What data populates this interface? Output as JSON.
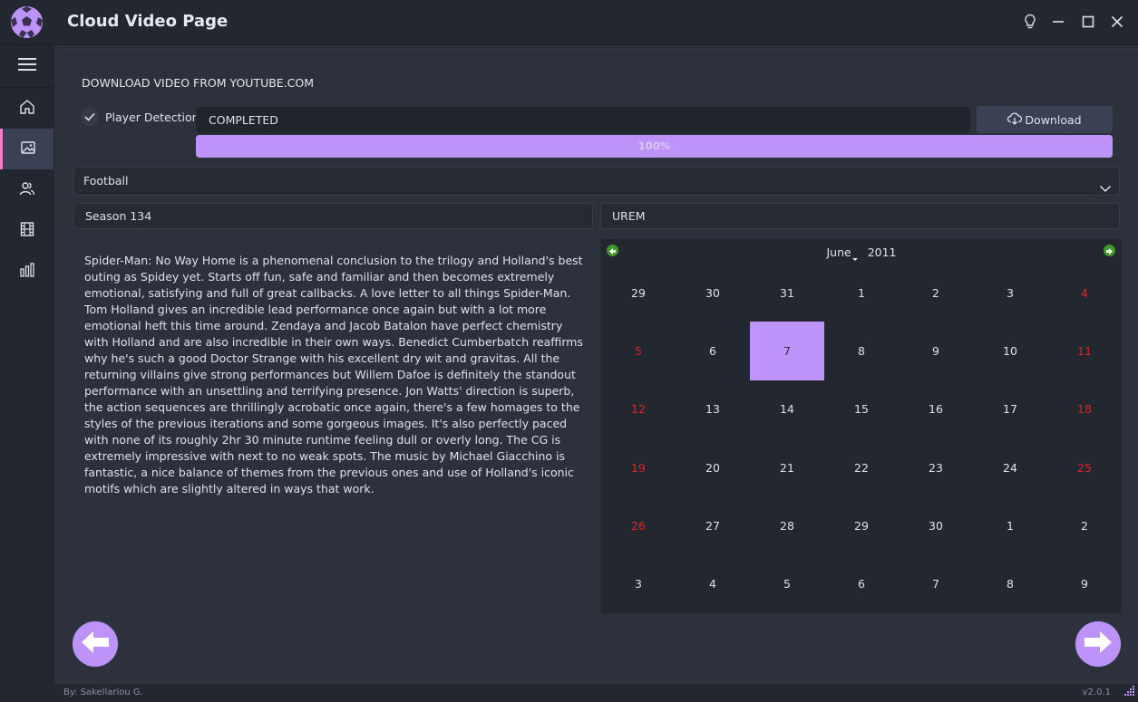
{
  "window": {
    "title": "Cloud Video Page",
    "buttons": [
      "lightbulb-icon",
      "minimize-icon",
      "maximize-icon",
      "close-icon"
    ]
  },
  "sidebar": {
    "items": [
      {
        "icon": "menu-icon"
      },
      {
        "icon": "home-icon"
      },
      {
        "icon": "image-icon",
        "active": true
      },
      {
        "icon": "users-icon"
      },
      {
        "icon": "film-icon"
      },
      {
        "icon": "chart-icon"
      }
    ]
  },
  "download": {
    "section_label": "DOWNLOAD VIDEO FROM YOUTUBE.COM",
    "player_detection_label": "Player Detection",
    "player_detection_checked": true,
    "status_value": "COMPLETED",
    "download_button": "Download",
    "progress_label": "100%",
    "progress_value": 100
  },
  "form": {
    "sport_selected": "Football",
    "season_value": "Season 134",
    "team_value": "UREM"
  },
  "review_text": "Spider-Man: No Way Home is a phenomenal conclusion to the trilogy and Holland's best outing as Spidey yet. Starts off fun, safe and familiar and then becomes extremely emotional, satisfying and full of great callbacks. A love letter to all things Spider-Man. Tom Holland gives an incredible lead performance once again but with a lot more emotional heft this time around. Zendaya and Jacob Batalon have perfect chemistry with Holland and are also incredible in their own ways. Benedict Cumberbatch reaffirms why he's such a good Doctor Strange with his excellent dry wit and gravitas. All the returning villains give strong performances but Willem Dafoe is definitely the standout performance with an unsettling and terrifying presence. Jon Watts' direction is superb, the action sequences are thrillingly acrobatic once again, there's a few homages to the styles of the previous iterations and some gorgeous images. It's also perfectly paced with none of its roughly 2hr 30 minute runtime feeling dull or overly long. The CG is extremely impressive with next to no weak spots. The music by Michael Giacchino is fantastic, a nice balance of themes from the previous ones and use of Holland's iconic motifs which are slightly altered in ways that work.",
  "calendar": {
    "month": "June",
    "year": "2011",
    "weeks": [
      [
        "29",
        "30",
        "31",
        "1",
        "2",
        "3",
        "4"
      ],
      [
        "5",
        "6",
        "7",
        "8",
        "9",
        "10",
        "11"
      ],
      [
        "12",
        "13",
        "14",
        "15",
        "16",
        "17",
        "18"
      ],
      [
        "19",
        "20",
        "21",
        "22",
        "23",
        "24",
        "25"
      ],
      [
        "26",
        "27",
        "28",
        "29",
        "30",
        "1",
        "2"
      ],
      [
        "3",
        "4",
        "5",
        "6",
        "7",
        "8",
        "9"
      ]
    ],
    "selected": "7"
  },
  "footer": {
    "credits": "By: Sakellariou G.",
    "version": "v2.0.1"
  },
  "colors": {
    "accent": "#bd93f9",
    "active_border": "#ff79c6",
    "weekend": "#e0212b",
    "calendar_nav": "#3f9a2b"
  }
}
